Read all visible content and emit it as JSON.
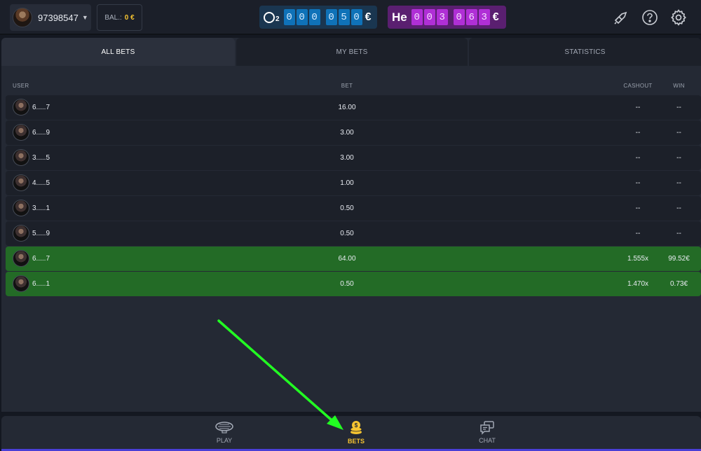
{
  "header": {
    "username": "97398547",
    "balance_label": "BAL.:",
    "balance_value": "0 €",
    "jackpot_o2": {
      "subscript": "2",
      "digits": [
        "0",
        "0",
        "0",
        "0",
        "5",
        "0"
      ],
      "currency": "€"
    },
    "jackpot_he": {
      "label": "He",
      "digits": [
        "0",
        "0",
        "3",
        "0",
        "6",
        "3"
      ],
      "currency": "€"
    },
    "icons": [
      "rocket-ticket-icon",
      "help-icon",
      "gear-icon"
    ]
  },
  "tabs": [
    {
      "label": "ALL BETS",
      "active": true
    },
    {
      "label": "MY BETS",
      "active": false
    },
    {
      "label": "STATISTICS",
      "active": false
    }
  ],
  "table": {
    "headers": {
      "user": "USER",
      "bet": "BET",
      "cashout": "CASHOUT",
      "win": "WIN"
    },
    "rows": [
      {
        "user": "6.....7",
        "bet": "16.00",
        "cashout": "--",
        "win": "--",
        "won": false
      },
      {
        "user": "6.....9",
        "bet": "3.00",
        "cashout": "--",
        "win": "--",
        "won": false
      },
      {
        "user": "3.....5",
        "bet": "3.00",
        "cashout": "--",
        "win": "--",
        "won": false
      },
      {
        "user": "4.....5",
        "bet": "1.00",
        "cashout": "--",
        "win": "--",
        "won": false
      },
      {
        "user": "3.....1",
        "bet": "0.50",
        "cashout": "--",
        "win": "--",
        "won": false
      },
      {
        "user": "5.....9",
        "bet": "0.50",
        "cashout": "--",
        "win": "--",
        "won": false
      },
      {
        "user": "6.....7",
        "bet": "64.00",
        "cashout": "1.555x",
        "win": "99.52€",
        "won": true
      },
      {
        "user": "6.....1",
        "bet": "0.50",
        "cashout": "1.470x",
        "win": "0.73€",
        "won": true
      }
    ]
  },
  "bottom_nav": [
    {
      "label": "PLAY",
      "icon": "blimp-icon",
      "active": false
    },
    {
      "label": "BETS",
      "icon": "coins-icon",
      "active": true
    },
    {
      "label": "CHAT",
      "icon": "chat-icon",
      "active": false
    }
  ],
  "colors": {
    "background": "#141821",
    "panel": "#242934",
    "row": "#1c2029",
    "win_row": "#236b26",
    "accent_gold": "#f6c431",
    "jackpot_o2": "#0f72b8",
    "jackpot_he": "#b02fd6",
    "annotation_arrow": "#22ff22"
  }
}
